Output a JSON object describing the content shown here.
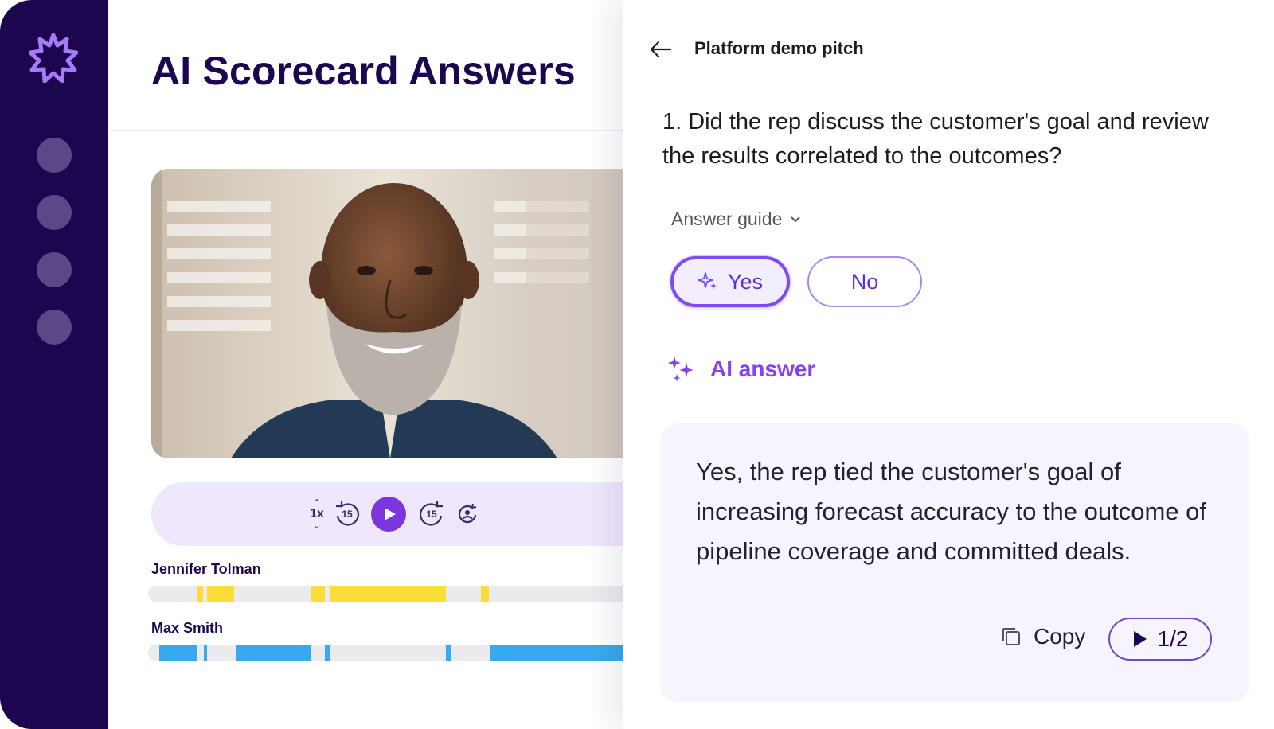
{
  "app": {
    "title": "AI Scorecard Answers",
    "accent": "#7c4cf0",
    "sidebar_bg": "#1d0650",
    "logo_icon": "starburst-logo-icon",
    "nav_items": 4
  },
  "player": {
    "speed_label": "1x",
    "rewind_label": "15",
    "forward_label": "15",
    "play_icon": "play-icon",
    "speakers": [
      {
        "name": "Jennifer Tolman",
        "color": "#fbdd3a"
      },
      {
        "name": "Max Smith",
        "color": "#37aaef"
      }
    ]
  },
  "panel": {
    "back_icon": "arrow-left-icon",
    "title": "Platform demo pitch",
    "question": "1. Did the rep discuss the customer's goal and review the results correlated to the outcomes?",
    "answer_guide_label": "Answer guide",
    "yes_label": "Yes",
    "no_label": "No",
    "selected": "Yes",
    "ai_answer_label": "AI answer",
    "answer_text": "Yes, the rep tied the customer's goal of increasing forecast accuracy to the outcome of pipeline coverage and committed deals.",
    "copy_label": "Copy",
    "clip_label": "1/2"
  }
}
